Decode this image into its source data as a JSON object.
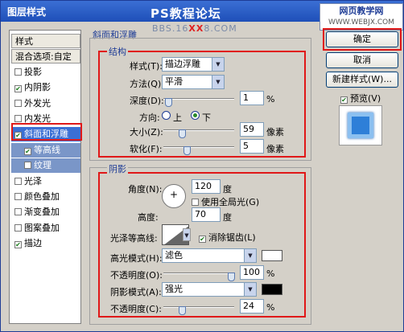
{
  "window": {
    "title": "图层样式"
  },
  "watermark": {
    "title": "PS教程论坛",
    "sub_a": "BBS.16",
    "sub_b": "XX",
    "sub_c": "8.COM"
  },
  "badge": {
    "title": "网页教学网",
    "sub": "WWW.WEBJX.COM"
  },
  "left_panel": {
    "items": [
      {
        "label": "样式",
        "checked": null,
        "state": "header"
      },
      {
        "label": "混合选项:自定",
        "checked": null,
        "state": "header"
      },
      {
        "label": "投影",
        "checked": false,
        "state": "normal"
      },
      {
        "label": "内阴影",
        "checked": true,
        "state": "normal"
      },
      {
        "label": "外发光",
        "checked": false,
        "state": "normal"
      },
      {
        "label": "内发光",
        "checked": false,
        "state": "normal"
      },
      {
        "label": "斜面和浮雕",
        "checked": true,
        "state": "selected"
      },
      {
        "label": "等高线",
        "checked": true,
        "state": "sub"
      },
      {
        "label": "纹理",
        "checked": false,
        "state": "sub"
      },
      {
        "label": "光泽",
        "checked": false,
        "state": "normal"
      },
      {
        "label": "颜色叠加",
        "checked": false,
        "state": "normal"
      },
      {
        "label": "渐变叠加",
        "checked": false,
        "state": "normal"
      },
      {
        "label": "图案叠加",
        "checked": false,
        "state": "normal"
      },
      {
        "label": "描边",
        "checked": true,
        "state": "normal"
      }
    ]
  },
  "bevel": {
    "group_title": "斜面和浮雕",
    "structure_title": "结构",
    "style_label": "样式(T):",
    "style_value": "描边浮雕",
    "method_label": "方法(Q):",
    "method_value": "平滑",
    "depth_label": "深度(D):",
    "depth_value": "1",
    "depth_unit": "%",
    "depth_level": 0.02,
    "direction_label": "方向:",
    "dir_up": "上",
    "dir_down": "下",
    "direction": "下",
    "size_label": "大小(Z):",
    "size_value": "59",
    "size_unit": "像素",
    "size_level": 0.24,
    "soften_label": "软化(F):",
    "soften_value": "5",
    "soften_unit": "像素",
    "soften_level": 0.31
  },
  "shading": {
    "title": "阴影",
    "angle_label": "角度(N):",
    "angle_value": "120",
    "angle_unit": "度",
    "global_light_label": "使用全局光(G)",
    "global_light": false,
    "altitude_label": "高度:",
    "altitude_value": "70",
    "altitude_unit": "度",
    "gloss_label": "光泽等高线:",
    "antialias_label": "消除锯齿(L)",
    "antialias": true,
    "highlight_mode_label": "高光模式(H):",
    "highlight_mode": "滤色",
    "highlight_color": "#ffffff",
    "highlight_opacity_label": "不透明度(O):",
    "highlight_opacity": "100",
    "highlight_opacity_level": 1.0,
    "pct": "%",
    "shadow_mode_label": "阴影模式(A):",
    "shadow_mode": "强光",
    "shadow_color": "#000000",
    "shadow_opacity_label": "不透明度(C):",
    "shadow_opacity": "24",
    "shadow_opacity_level": 0.24
  },
  "right": {
    "ok": "确定",
    "cancel": "取消",
    "new_style": "新建样式(W)...",
    "preview_label": "预览(V)",
    "preview": true
  },
  "colors": {
    "accent": "#e01818",
    "selection": "#3b6fd4",
    "title_bar": "#1e4fb8"
  }
}
